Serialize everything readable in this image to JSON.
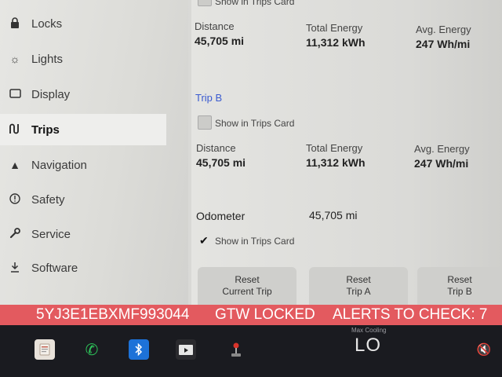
{
  "sidebar": {
    "items": [
      {
        "label": "Locks",
        "icon": "lock-icon"
      },
      {
        "label": "Lights",
        "icon": "sun-icon"
      },
      {
        "label": "Display",
        "icon": "display-icon"
      },
      {
        "label": "Trips",
        "icon": "trips-icon",
        "active": true
      },
      {
        "label": "Navigation",
        "icon": "navigation-arrow-icon"
      },
      {
        "label": "Safety",
        "icon": "safety-icon"
      },
      {
        "label": "Service",
        "icon": "wrench-icon"
      },
      {
        "label": "Software",
        "icon": "download-icon"
      }
    ]
  },
  "trip_top": {
    "show_in_trips_card": "Show in Trips Card",
    "distance_label": "Distance",
    "distance_value": "45,705 mi",
    "energy_label": "Total Energy",
    "energy_value": "11,312 kWh",
    "avg_label": "Avg. Energy",
    "avg_value": "247 Wh/mi"
  },
  "trip_b": {
    "title": "Trip B",
    "show_in_trips_card": "Show in Trips Card",
    "distance_label": "Distance",
    "distance_value": "45,705 mi",
    "energy_label": "Total Energy",
    "energy_value": "11,312 kWh",
    "avg_label": "Avg. Energy",
    "avg_value": "247 Wh/mi"
  },
  "odometer": {
    "label": "Odometer",
    "value": "45,705 mi",
    "show_in_trips_card": "Show in Trips Card",
    "checked": true
  },
  "reset_buttons": [
    {
      "line1": "Reset",
      "line2": "Current Trip"
    },
    {
      "line1": "Reset",
      "line2": "Trip A"
    },
    {
      "line1": "Reset",
      "line2": "Trip B"
    }
  ],
  "alert_bar": {
    "vin": "5YJ3E1EBXMF993044",
    "status": "GTW LOCKED",
    "alerts": "ALERTS TO CHECK: 7",
    "color": "#e35a5f"
  },
  "taskbar": {
    "icons": [
      "document-icon",
      "phone-icon",
      "bluetooth-icon",
      "media-icon",
      "joystick-icon"
    ],
    "climate_caption": "Max Cooling",
    "climate_value": "LO",
    "volume_icon": "volume-muted-icon"
  }
}
